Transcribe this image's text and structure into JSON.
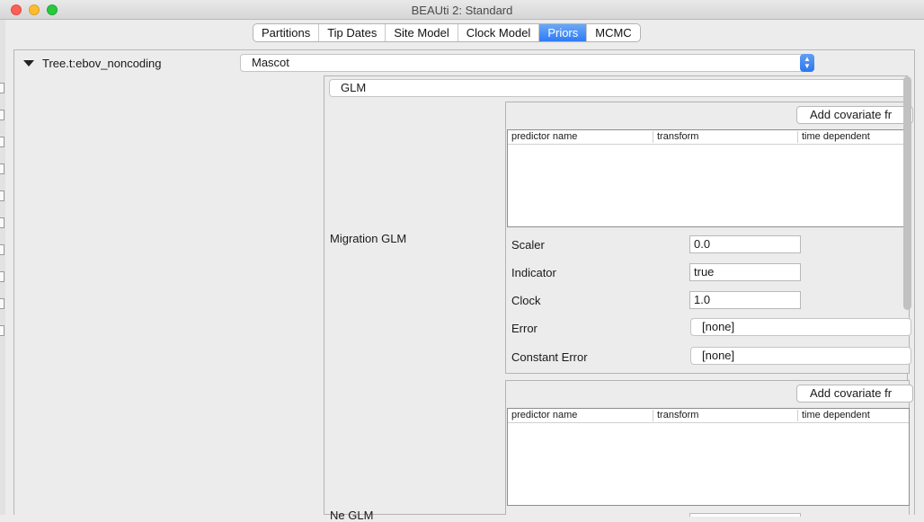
{
  "window": {
    "title": "BEAUti 2: Standard"
  },
  "tabs": [
    "Partitions",
    "Tip Dates",
    "Site Model",
    "Clock Model",
    "Priors",
    "MCMC"
  ],
  "active_tab": "Priors",
  "tree": {
    "label": "Tree.t:ebov_noncoding",
    "model_select": "Mascot"
  },
  "dynamics_select": "GLM",
  "migration_glm": {
    "label": "Migration GLM",
    "add_button": "Add covariate fr",
    "columns": [
      "predictor name",
      "transform",
      "time dependent"
    ],
    "params": [
      {
        "label": "Scaler",
        "value": "0.0"
      },
      {
        "label": "Indicator",
        "value": "true"
      },
      {
        "label": "Clock",
        "value": "1.0"
      }
    ],
    "error": {
      "label": "Error",
      "value": "[none]"
    },
    "constant_error": {
      "label": "Constant Error",
      "value": "[none]"
    }
  },
  "ne_glm": {
    "label": "Ne GLM",
    "add_button": "Add covariate fr",
    "columns": [
      "predictor name",
      "transform",
      "time dependent"
    ]
  },
  "colors": {
    "accent": "#2f7bf4",
    "background": "#ececec"
  }
}
